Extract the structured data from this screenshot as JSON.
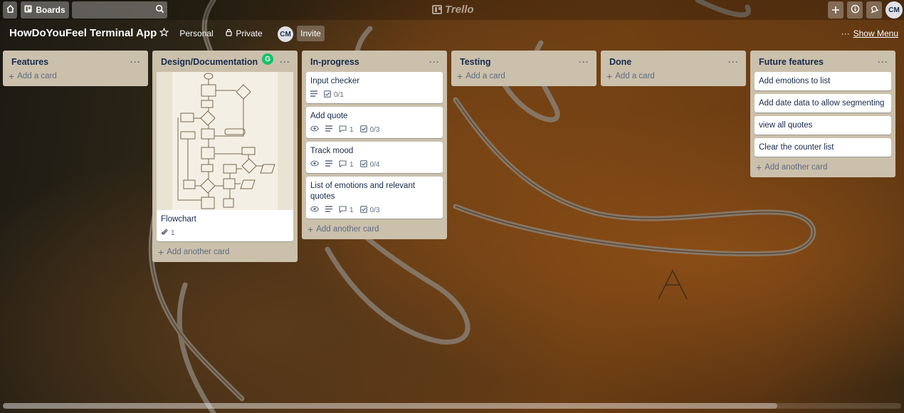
{
  "header": {
    "boards_label": "Boards",
    "logo_text": "Trello",
    "avatar_initials": "CM",
    "icons": [
      "home-icon",
      "boards-icon",
      "search-icon",
      "plus-icon",
      "info-icon",
      "bell-icon"
    ]
  },
  "board": {
    "title": "HowDoYouFeel Terminal App",
    "personal_label": "Personal",
    "private_label": "Private",
    "member_initials": "CM",
    "invite_label": "Invite",
    "menu_dots": "···",
    "show_menu_label": "Show Menu"
  },
  "lists": [
    {
      "title": "Features",
      "menu": "···",
      "cards": [],
      "add_label": "Add a card"
    },
    {
      "title": "Design/Documentation",
      "menu": "···",
      "badge_letter": "G",
      "cards": [
        {
          "title": "Flowchart",
          "has_image": true,
          "attachments": "1"
        }
      ],
      "add_label": "Add another card"
    },
    {
      "title": "In-progress",
      "menu": "···",
      "cards": [
        {
          "title": "Input checker",
          "checklist": "0/1"
        },
        {
          "title": "Add quote",
          "comments": "1",
          "checklist": "0/3"
        },
        {
          "title": "Track mood",
          "comments": "1",
          "checklist": "0/4"
        },
        {
          "title": "List of emotions and relevant quotes",
          "comments": "1",
          "checklist": "0/3"
        }
      ],
      "add_label": "Add another card"
    },
    {
      "title": "Testing",
      "menu": "···",
      "cards": [],
      "add_label": "Add a card"
    },
    {
      "title": "Done",
      "menu": "···",
      "cards": [],
      "add_label": "Add a card"
    },
    {
      "title": "Future features",
      "menu": "···",
      "cards": [
        {
          "title": "Add emotions to list"
        },
        {
          "title": "Add date data to allow segmenting"
        },
        {
          "title": "view all quotes"
        },
        {
          "title": "Clear the counter list"
        }
      ],
      "add_label": "Add another card"
    }
  ],
  "colors": {
    "list_bg": "#cbc0ab",
    "card_bg": "#ffffff",
    "grammarly_green": "#15c26b"
  }
}
